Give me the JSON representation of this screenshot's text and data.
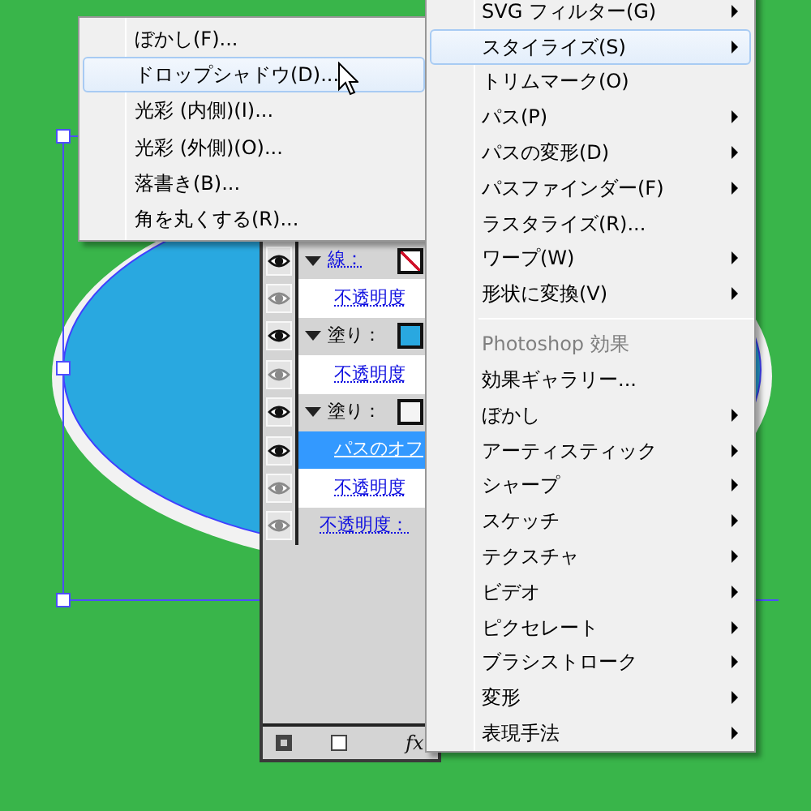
{
  "menu": {
    "items": [
      {
        "kind": "item",
        "label": "SVG フィルター(G)",
        "selected": false,
        "has_submenu": true
      },
      {
        "kind": "item",
        "label": "スタイライズ(S)",
        "selected": true,
        "has_submenu": true
      },
      {
        "kind": "item",
        "label": "トリムマーク(O)",
        "selected": false,
        "has_submenu": false
      },
      {
        "kind": "item",
        "label": "パス(P)",
        "selected": false,
        "has_submenu": true
      },
      {
        "kind": "item",
        "label": "パスの変形(D)",
        "selected": false,
        "has_submenu": true
      },
      {
        "kind": "item",
        "label": "パスファインダー(F)",
        "selected": false,
        "has_submenu": true
      },
      {
        "kind": "item",
        "label": "ラスタライズ(R)...",
        "selected": false,
        "has_submenu": false
      },
      {
        "kind": "item",
        "label": "ワープ(W)",
        "selected": false,
        "has_submenu": true
      },
      {
        "kind": "item",
        "label": "形状に変換(V)",
        "selected": false,
        "has_submenu": true
      },
      {
        "kind": "separator"
      },
      {
        "kind": "header",
        "label": "Photoshop 効果"
      },
      {
        "kind": "item",
        "label": "効果ギャラリー...",
        "selected": false,
        "has_submenu": false
      },
      {
        "kind": "item",
        "label": "ぼかし",
        "selected": false,
        "has_submenu": true
      },
      {
        "kind": "item",
        "label": "アーティスティック",
        "selected": false,
        "has_submenu": true
      },
      {
        "kind": "item",
        "label": "シャープ",
        "selected": false,
        "has_submenu": true
      },
      {
        "kind": "item",
        "label": "スケッチ",
        "selected": false,
        "has_submenu": true
      },
      {
        "kind": "item",
        "label": "テクスチャ",
        "selected": false,
        "has_submenu": true
      },
      {
        "kind": "item",
        "label": "ビデオ",
        "selected": false,
        "has_submenu": true
      },
      {
        "kind": "item",
        "label": "ピクセレート",
        "selected": false,
        "has_submenu": true
      },
      {
        "kind": "item",
        "label": "ブラシストローク",
        "selected": false,
        "has_submenu": true
      },
      {
        "kind": "item",
        "label": "変形",
        "selected": false,
        "has_submenu": true
      },
      {
        "kind": "item",
        "label": "表現手法",
        "selected": false,
        "has_submenu": true
      }
    ]
  },
  "submenu": {
    "items": [
      {
        "label": "ぼかし(F)...",
        "selected": false
      },
      {
        "label": "ドロップシャドウ(D)...",
        "selected": true
      },
      {
        "label": "光彩 (内側)(I)...",
        "selected": false
      },
      {
        "label": "光彩 (外側)(O)...",
        "selected": false
      },
      {
        "label": "落書き(B)...",
        "selected": false
      },
      {
        "label": "角を丸くする(R)...",
        "selected": false
      }
    ]
  },
  "appearance_panel": {
    "rows": [
      {
        "label": "線：",
        "visible": true,
        "link": true,
        "selected": false,
        "expanded": true,
        "no_color": true,
        "children": [
          {
            "label": "不透明度",
            "visible": false,
            "link": true,
            "selected": false
          }
        ]
      },
      {
        "label": "塗り：",
        "visible": true,
        "link": false,
        "selected": false,
        "expanded": true,
        "color": "#29a8e0",
        "children": [
          {
            "label": "不透明度",
            "visible": false,
            "link": true,
            "selected": false
          }
        ]
      },
      {
        "label": "塗り：",
        "visible": true,
        "link": false,
        "selected": false,
        "expanded": true,
        "color": "#f4f4f4",
        "children": [
          {
            "label": "パスのオフ",
            "visible": true,
            "link": true,
            "selected": true
          },
          {
            "label": "不透明度",
            "visible": false,
            "link": true,
            "selected": false
          }
        ]
      },
      {
        "label": "不透明度：",
        "visible": false,
        "link": true,
        "selected": false
      }
    ],
    "fx_label": "fx"
  }
}
